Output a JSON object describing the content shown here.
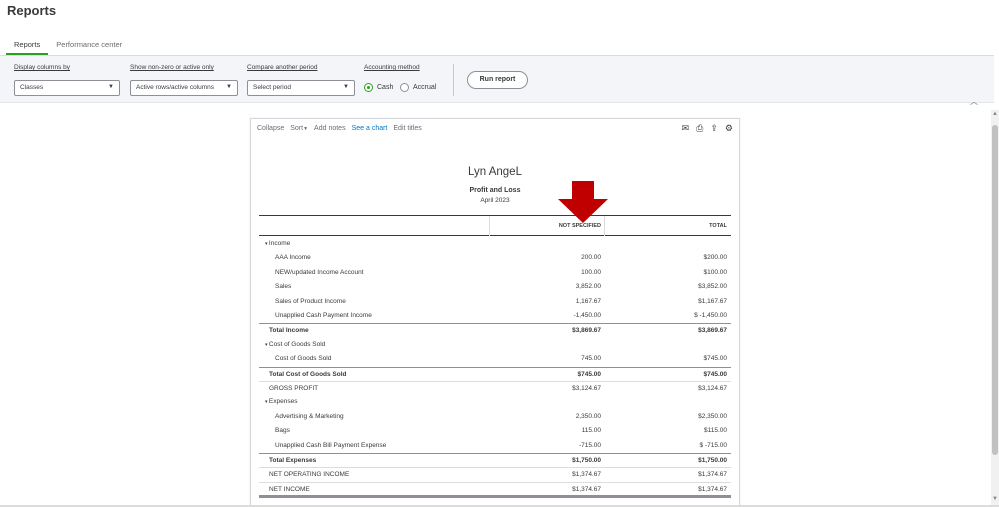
{
  "page": {
    "title": "Reports"
  },
  "tabs": [
    {
      "label": "Reports",
      "active": true
    },
    {
      "label": "Performance center",
      "active": false
    }
  ],
  "filters": {
    "display_columns": {
      "label": "Display columns by",
      "value": "Classes"
    },
    "show_nonzero": {
      "label": "Show non-zero or active only",
      "value": "Active rows/active columns"
    },
    "compare": {
      "label": "Compare another period",
      "value": "Select period"
    },
    "accounting": {
      "label": "Accounting method",
      "cash": "Cash",
      "accrual": "Accrual",
      "selected": "Cash"
    },
    "run_button": "Run report"
  },
  "report": {
    "toolbar": {
      "collapse": "Collapse",
      "sort": "Sort",
      "add_notes": "Add notes",
      "see_chart": "See a chart",
      "edit_titles": "Edit titles"
    },
    "company": "Lyn AngeL",
    "name": "Profit and Loss",
    "period": "April 2023",
    "columns": [
      "NOT SPECIFIED",
      "TOTAL"
    ],
    "rows": [
      {
        "label": "Income",
        "type": "section",
        "v1": "",
        "v2": ""
      },
      {
        "label": "AAA Income",
        "type": "item",
        "v1": "200.00",
        "v2": "$200.00"
      },
      {
        "label": "NEW/updated Income Account",
        "type": "item",
        "v1": "100.00",
        "v2": "$100.00"
      },
      {
        "label": "Sales",
        "type": "item",
        "v1": "3,852.00",
        "v2": "$3,852.00"
      },
      {
        "label": "Sales of Product Income",
        "type": "item",
        "v1": "1,167.67",
        "v2": "$1,167.67"
      },
      {
        "label": "Unapplied Cash Payment Income",
        "type": "item",
        "v1": "-1,450.00",
        "v2": "$ -1,450.00"
      },
      {
        "label": "Total Income",
        "type": "total",
        "v1": "$3,869.67",
        "v2": "$3,869.67"
      },
      {
        "label": "Cost of Goods Sold",
        "type": "section",
        "v1": "",
        "v2": ""
      },
      {
        "label": "Cost of Goods Sold",
        "type": "item",
        "v1": "745.00",
        "v2": "$745.00"
      },
      {
        "label": "Total Cost of Goods Sold",
        "type": "total",
        "v1": "$745.00",
        "v2": "$745.00"
      },
      {
        "label": "GROSS PROFIT",
        "type": "net",
        "v1": "$3,124.67",
        "v2": "$3,124.67"
      },
      {
        "label": "Expenses",
        "type": "section",
        "v1": "",
        "v2": ""
      },
      {
        "label": "Advertising & Marketing",
        "type": "item",
        "v1": "2,350.00",
        "v2": "$2,350.00"
      },
      {
        "label": "Bags",
        "type": "item",
        "v1": "115.00",
        "v2": "$115.00"
      },
      {
        "label": "Unapplied Cash Bill Payment Expense",
        "type": "item",
        "v1": "-715.00",
        "v2": "$ -715.00"
      },
      {
        "label": "Total Expenses",
        "type": "total",
        "v1": "$1,750.00",
        "v2": "$1,750.00"
      },
      {
        "label": "NET OPERATING INCOME",
        "type": "net",
        "v1": "$1,374.67",
        "v2": "$1,374.67"
      },
      {
        "label": "NET INCOME",
        "type": "net",
        "v1": "$1,374.67",
        "v2": "$1,374.67"
      }
    ]
  },
  "colors": {
    "accent": "#2ca01c",
    "link": "#0077c5",
    "annotation_arrow": "#c00000"
  }
}
